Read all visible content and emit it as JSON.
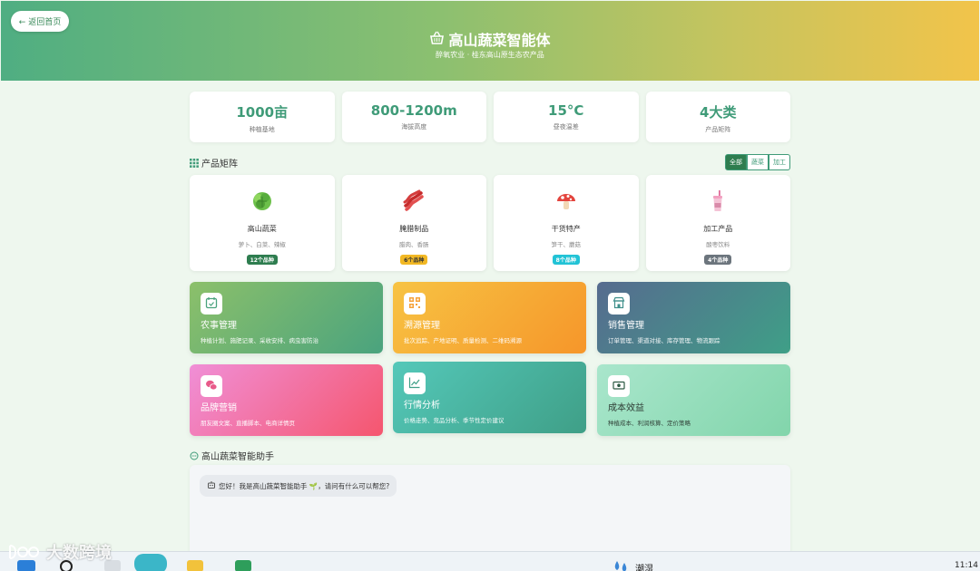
{
  "header": {
    "back_label": "← 返回首页",
    "title": "高山蔬菜智能体",
    "subtitle": "醉氧农业 · 桂东高山原生态农产品"
  },
  "stats": [
    {
      "value": "1000亩",
      "label": "种植基地"
    },
    {
      "value": "800-1200m",
      "label": "海拔高度"
    },
    {
      "value": "15°C",
      "label": "昼夜温差"
    },
    {
      "value": "4大类",
      "label": "产品矩阵"
    }
  ],
  "product_section": {
    "title": "产品矩阵",
    "filters": [
      "全部",
      "蔬菜",
      "加工"
    ]
  },
  "products": [
    {
      "name": "高山蔬菜",
      "desc": "萝卜、白菜、辣椒",
      "badge": "12个品种",
      "badge_color": "#2e7d4f",
      "icon": "lettuce-icon"
    },
    {
      "name": "腌腊制品",
      "desc": "腊肉、香肠",
      "badge": "6个品种",
      "badge_color": "#f2b824",
      "icon": "bacon-icon"
    },
    {
      "name": "干货特产",
      "desc": "笋干、蘑菇",
      "badge": "8个品种",
      "badge_color": "#22c3d6",
      "icon": "mushroom-icon"
    },
    {
      "name": "加工产品",
      "desc": "酸枣饮料",
      "badge": "4个品种",
      "badge_color": "#6c757d",
      "icon": "drink-cup-icon"
    }
  ],
  "modules": [
    {
      "title": "农事管理",
      "desc": "种植计划、施肥记录、采收安排、病虫害防治",
      "icon": "calendar-check-icon",
      "colors": [
        "#8cc06a",
        "#4aa37e"
      ]
    },
    {
      "title": "溯源管理",
      "desc": "批次追踪、产地证明、质量检测、二维码溯源",
      "icon": "qrcode-icon",
      "colors": [
        "#f7c343",
        "#f6962a"
      ]
    },
    {
      "title": "销售管理",
      "desc": "订单管理、渠道对接、库存管理、物流跟踪",
      "icon": "store-icon",
      "colors": [
        "#566b8f",
        "#3f9f87"
      ]
    },
    {
      "title": "品牌营销",
      "desc": "朋友圈文案、直播脚本、电商详情页",
      "icon": "wechat-icon",
      "colors": [
        "#f08fd7",
        "#f5566e"
      ]
    },
    {
      "title": "行情分析",
      "desc": "价格走势、竞品分析、季节性定价建议",
      "icon": "chart-line-icon",
      "colors": [
        "#54c8b9",
        "#3f9f87"
      ]
    },
    {
      "title": "成本效益",
      "desc": "种植成本、利润核算、定价策略",
      "icon": "cash-icon",
      "colors": [
        "#a9e6cc",
        "#82d5ab"
      ]
    }
  ],
  "chat": {
    "title": "高山蔬菜智能助手",
    "greeting": "您好！我是高山蔬菜智能助手 🌱，请问有什么可以帮您?"
  },
  "taskbar": {
    "watermark": "大数跨境",
    "weather": "潮湿",
    "clock": "11:14"
  }
}
